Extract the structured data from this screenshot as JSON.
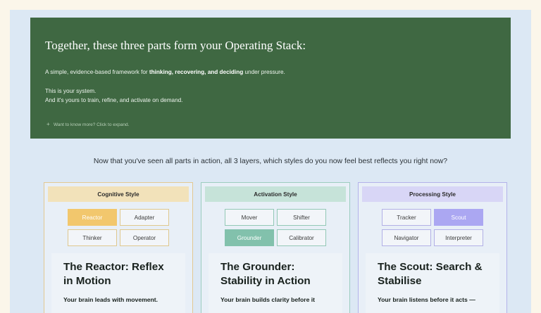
{
  "hero": {
    "title": "Together, these three parts form your Operating Stack:",
    "line1_before": "A simple, evidence-based framework for ",
    "line1_bold": "thinking, recovering, and deciding",
    "line1_after": " under pressure.",
    "line2": "This is your system.",
    "line3": "And it's yours to train, refine, and activate on demand.",
    "expand_label": "Want to know more? Click to expand."
  },
  "question": "Now that you've seen all parts in action, all 3 layers, which styles do you now feel best reflects you right now?",
  "cards": [
    {
      "header": "Cognitive Style",
      "chips": [
        "Reactor",
        "Adapter",
        "Thinker",
        "Operator"
      ],
      "selected": "Reactor",
      "title": "The Reactor: Reflex in Motion",
      "desc": "Your brain leads with movement."
    },
    {
      "header": "Activation Style",
      "chips": [
        "Mover",
        "Shifter",
        "Grounder",
        "Calibrator"
      ],
      "selected": "Grounder",
      "title": "The Grounder: Stability in Action",
      "desc": "Your brain builds clarity before it"
    },
    {
      "header": "Processing Style",
      "chips": [
        "Tracker",
        "Scout",
        "Navigator",
        "Interpreter"
      ],
      "selected": "Scout",
      "title": "The Scout: Search & Stabilise",
      "desc": "Your brain listens before it acts —"
    }
  ],
  "colors": {
    "hero_bg": "#3f6842",
    "stage_bg": "#dce8f4",
    "page_bg": "#fbf6ea",
    "cognitive_accent": "#f2c76d",
    "activation_accent": "#82c1ac",
    "processing_accent": "#aba7f2"
  },
  "icons": {
    "expand": "plus-icon"
  }
}
